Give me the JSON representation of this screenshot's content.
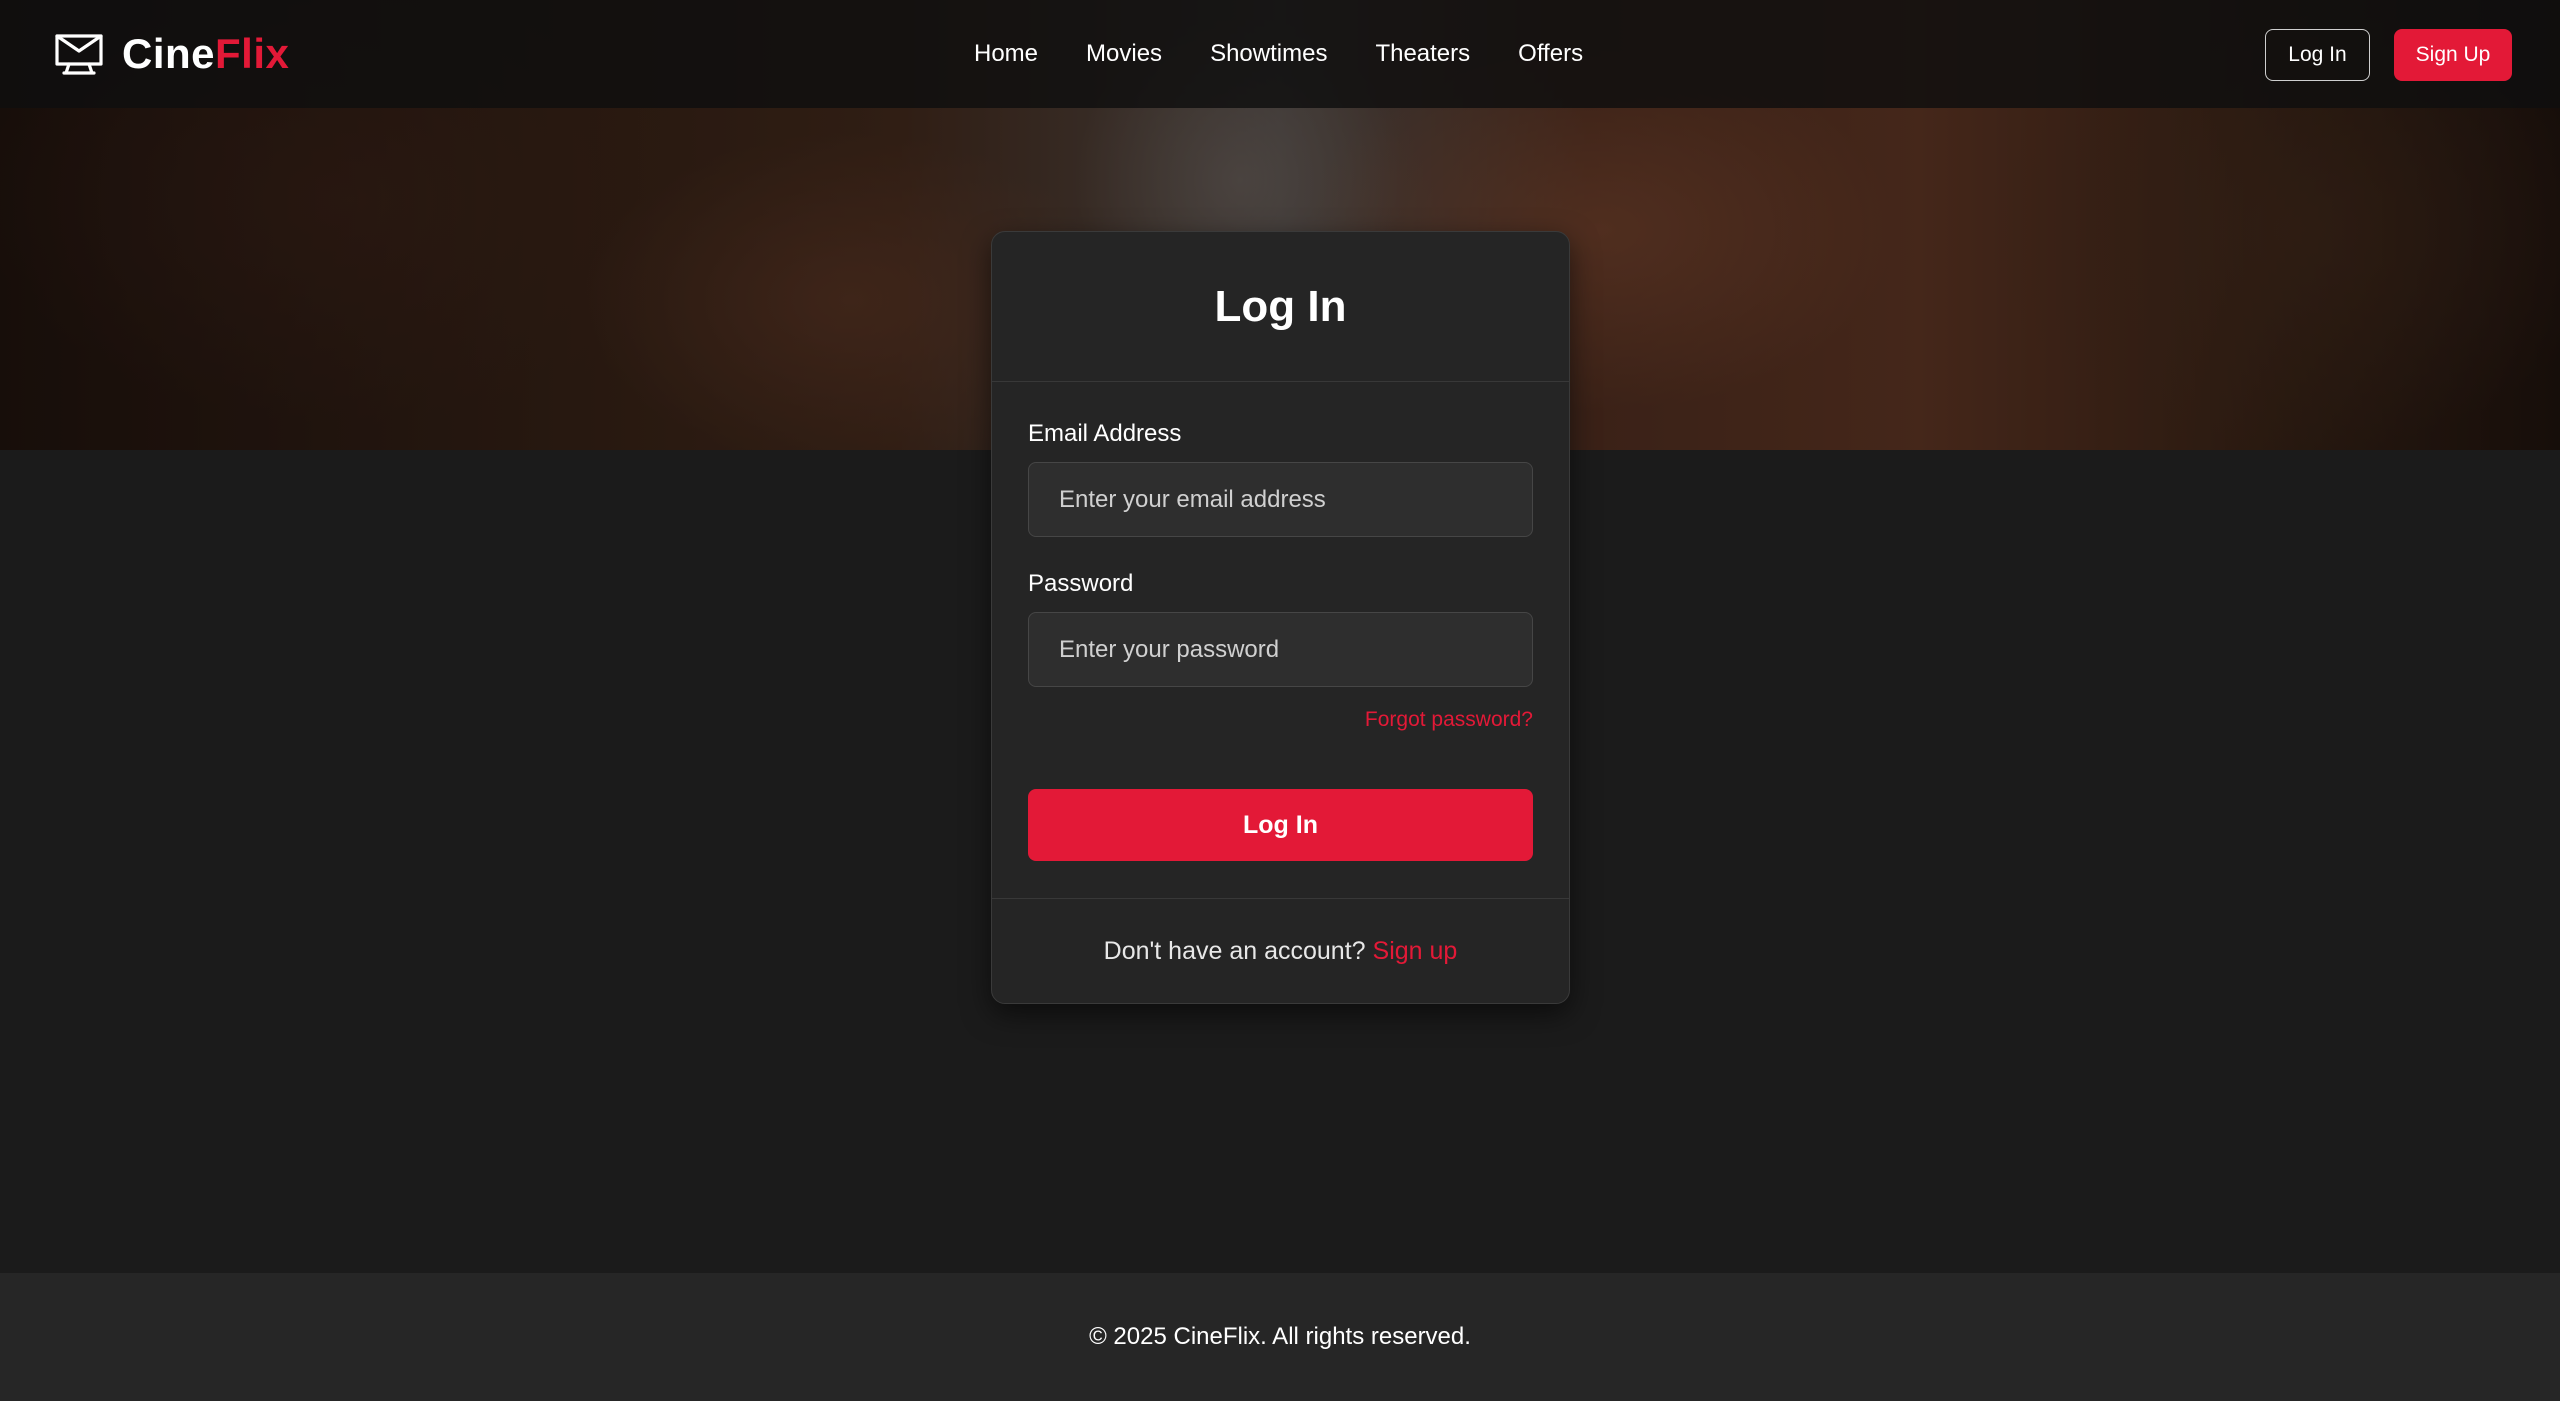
{
  "brand": {
    "name_part1": "Cine",
    "name_part2": "Flix",
    "icon": "cinema-screen-icon",
    "accent_color": "#e31937"
  },
  "nav": {
    "items": [
      {
        "label": "Home"
      },
      {
        "label": "Movies"
      },
      {
        "label": "Showtimes"
      },
      {
        "label": "Theaters"
      },
      {
        "label": "Offers"
      }
    ]
  },
  "header_actions": {
    "login_label": "Log In",
    "signup_label": "Sign Up"
  },
  "login_form": {
    "title": "Log In",
    "email": {
      "label": "Email Address",
      "placeholder": "Enter your email address",
      "value": ""
    },
    "password": {
      "label": "Password",
      "placeholder": "Enter your password",
      "value": ""
    },
    "forgot_label": "Forgot password?",
    "submit_label": "Log In",
    "no_account_text": "Don't have an account?",
    "signup_link_label": "Sign up"
  },
  "footer": {
    "copyright": "© 2025 CineFlix. All rights reserved."
  }
}
